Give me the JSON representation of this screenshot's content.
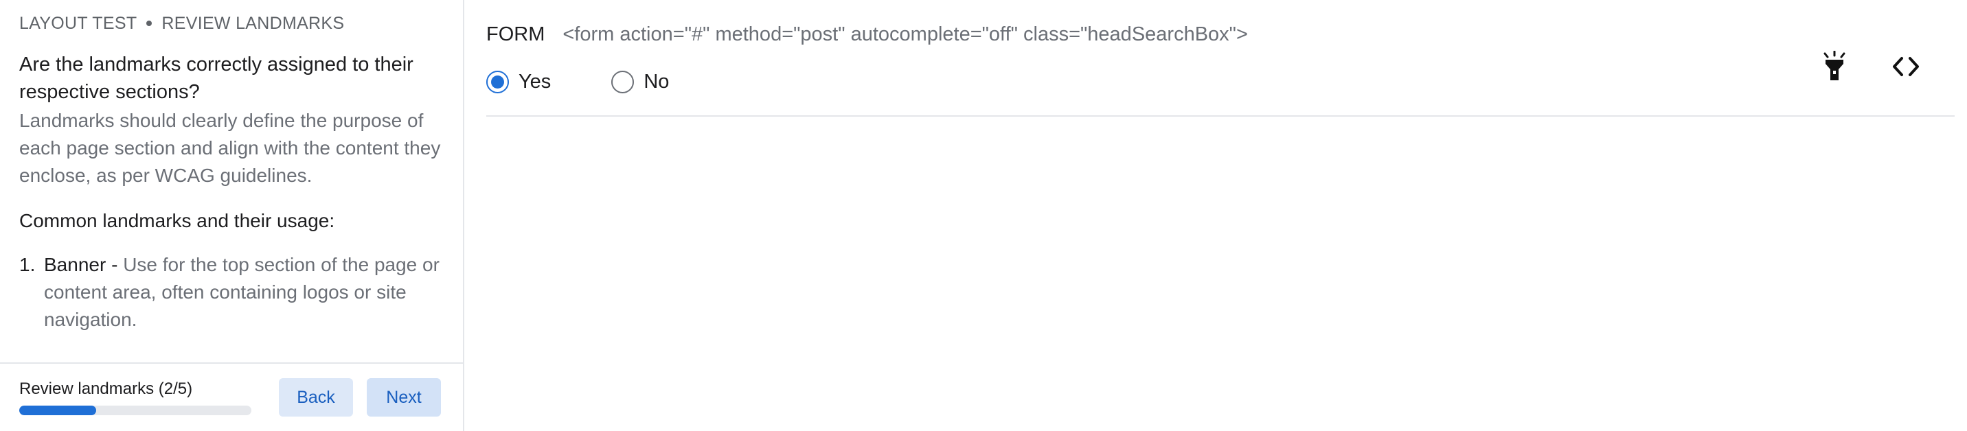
{
  "breadcrumb": {
    "test": "LAYOUT TEST",
    "step": "REVIEW LANDMARKS"
  },
  "question": "Are the landmarks correctly assigned to their respective sections?",
  "description": "Landmarks should clearly define the purpose of each page section and align with the content they enclose, as per WCAG guidelines.",
  "subheading": "Common landmarks and their usage:",
  "landmarks": [
    {
      "number": "1.",
      "term": "Banner",
      "separator": " - ",
      "description": "Use for the top section of the page or content area, often containing logos or site navigation."
    }
  ],
  "footer": {
    "progress_label": "Review landmarks (2/5)",
    "progress_fraction": 0.33,
    "back_label": "Back",
    "next_label": "Next"
  },
  "element": {
    "type": "FORM",
    "code": "<form action=\"#\" method=\"post\" autocomplete=\"off\" class=\"headSearchBox\">"
  },
  "answer": {
    "options": [
      {
        "label": "Yes",
        "selected": true
      },
      {
        "label": "No",
        "selected": false
      }
    ]
  },
  "tools": {
    "highlight_icon": "flashlight-icon",
    "code_icon": "code-brackets-icon"
  },
  "colors": {
    "accent": "#1f6fd6",
    "button_bg": "#dde8f8",
    "muted_text": "#6b6f76"
  }
}
